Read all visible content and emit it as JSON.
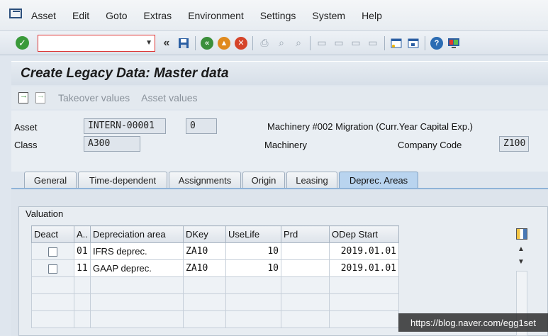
{
  "menubar": {
    "items": [
      "Asset",
      "Edit",
      "Goto",
      "Extras",
      "Environment",
      "Settings",
      "System",
      "Help"
    ]
  },
  "toolbar": {
    "command_value": "",
    "back_symbol": "«"
  },
  "title": "Create Legacy Data: Master data",
  "app_toolbar": {
    "takeover_label": "Takeover values",
    "asset_values_label": "Asset values"
  },
  "header": {
    "asset_label": "Asset",
    "asset_value": "INTERN-00001",
    "subnumber_value": "0",
    "asset_description": "Machinery #002 Migration (Curr.Year Capital Exp.)",
    "class_label": "Class",
    "class_value": "A300",
    "class_description": "Machinery",
    "company_code_label": "Company Code",
    "company_code_value": "Z100"
  },
  "tabs": [
    "General",
    "Time-dependent",
    "Assignments",
    "Origin",
    "Leasing",
    "Deprec. Areas"
  ],
  "active_tab": "Deprec. Areas",
  "valuation": {
    "group_title": "Valuation",
    "columns": [
      "Deact",
      "A..",
      "Depreciation area",
      "DKey",
      "UseLife",
      "Prd",
      "ODep Start"
    ],
    "rows": [
      {
        "area": "01",
        "name": "IFRS deprec.",
        "dkey": "ZA10",
        "uselife": "10",
        "prd": "",
        "odep_start": "2019.01.01"
      },
      {
        "area": "11",
        "name": "GAAP deprec.",
        "dkey": "ZA10",
        "uselife": "10",
        "prd": "",
        "odep_start": "2019.01.01"
      }
    ]
  },
  "watermark": "https://blog.naver.com/egg1set",
  "colors": {
    "active_tab": "#b9d4ef",
    "command_border": "#dd3333",
    "check_green": "#3a9a3a"
  }
}
